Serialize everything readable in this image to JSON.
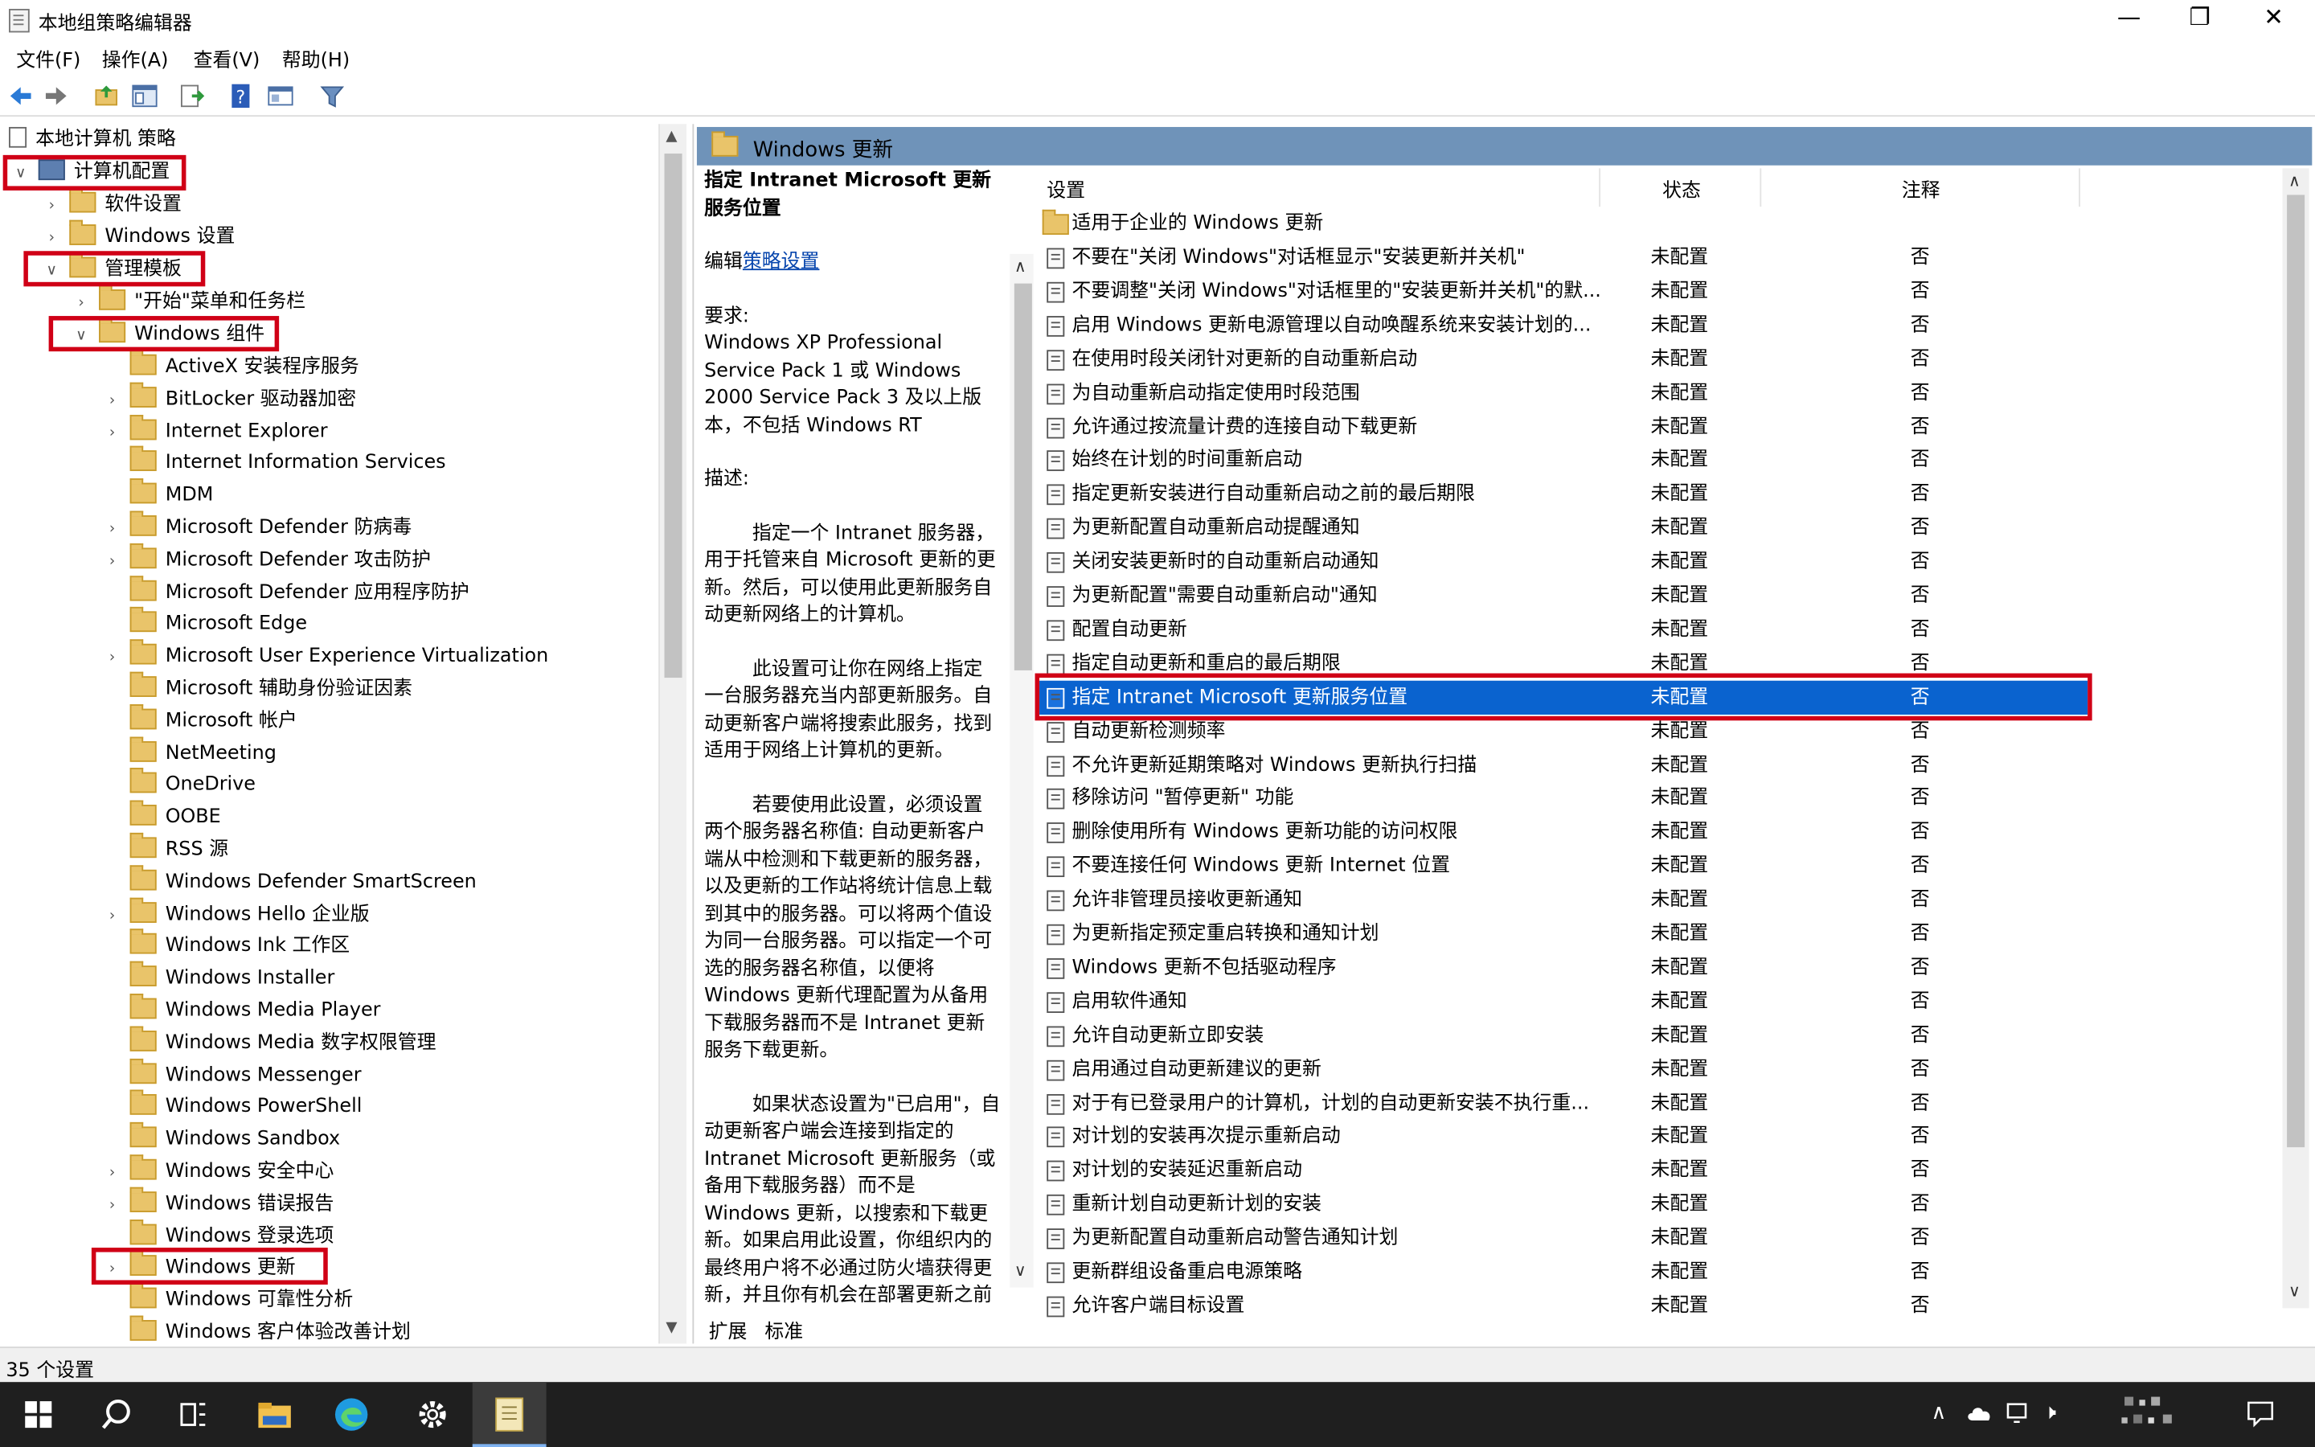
{
  "window": {
    "title": "本地组策略编辑器"
  },
  "menu": [
    "文件(F)",
    "操作(A)",
    "查看(V)",
    "帮助(H)"
  ],
  "tree": {
    "root": "本地计算机 策略",
    "computer_config": "计算机配置",
    "software_settings": "软件设置",
    "windows_settings": "Windows 设置",
    "admin_templates": "管理模板",
    "start_menu": "\"开始\"菜单和任务栏",
    "windows_components": "Windows 组件",
    "components": [
      "ActiveX 安装程序服务",
      "BitLocker 驱动器加密",
      "Internet Explorer",
      "Internet Information Services",
      "MDM",
      "Microsoft Defender 防病毒",
      "Microsoft Defender 攻击防护",
      "Microsoft Defender 应用程序防护",
      "Microsoft Edge",
      "Microsoft User Experience Virtualization",
      "Microsoft 辅助身份验证因素",
      "Microsoft 帐户",
      "NetMeeting",
      "OneDrive",
      "OOBE",
      "RSS 源",
      "Windows Defender SmartScreen",
      "Windows Hello 企业版",
      "Windows Ink 工作区",
      "Windows Installer",
      "Windows Media Player",
      "Windows Media 数字权限管理",
      "Windows Messenger",
      "Windows PowerShell",
      "Windows Sandbox",
      "Windows 安全中心",
      "Windows 错误报告",
      "Windows 登录选项",
      "Windows 更新",
      "Windows 可靠性分析",
      "Windows 客户体验改善计划"
    ]
  },
  "right_header": "Windows 更新",
  "description": {
    "title": "指定 Intranet Microsoft 更新服务位置",
    "edit_prefix": "编辑",
    "edit_link": "策略设置",
    "req_label": "要求:",
    "req_text": "Windows XP Professional Service Pack 1 或 Windows 2000 Service Pack 3 及以上版本，不包括 Windows RT",
    "desc_label": "描述:",
    "p1": "指定一个 Intranet 服务器，用于托管来自 Microsoft 更新的更新。然后，可以使用此更新服务自动更新网络上的计算机。",
    "p2": "此设置可让你在网络上指定一台服务器充当内部更新服务。自动更新客户端将搜索此服务，找到适用于网络上计算机的更新。",
    "p3": "若要使用此设置，必须设置两个服务器名称值: 自动更新客户端从中检测和下载更新的服务器，以及更新的工作站将统计信息上载到其中的服务器。可以将两个值设为同一台服务器。可以指定一个可选的服务器名称值，以便将 Windows 更新代理配置为从备用下载服务器而不是 Intranet 更新服务下载更新。",
    "p4": "如果状态设置为\"已启用\"，自动更新客户端会连接到指定的 Intranet Microsoft 更新服务（或备用下载服务器）而不是 Windows 更新，以搜索和下载更新。如果启用此设置，你组织内的最终用户将不必通过防火墙获得更新，并且你有机会在部署更新之前对其进行测试。"
  },
  "tabs": [
    "扩展",
    "标准"
  ],
  "columns": {
    "setting": "设置",
    "state": "状态",
    "note": "注释"
  },
  "folder_row": "适用于企业的 Windows 更新",
  "rows": [
    {
      "name": "不要在\"关闭 Windows\"对话框显示\"安装更新并关机\"",
      "state": "未配置",
      "note": "否"
    },
    {
      "name": "不要调整\"关闭 Windows\"对话框里的\"安装更新并关机\"的默...",
      "state": "未配置",
      "note": "否"
    },
    {
      "name": "启用 Windows 更新电源管理以自动唤醒系统来安装计划的...",
      "state": "未配置",
      "note": "否"
    },
    {
      "name": "在使用时段关闭针对更新的自动重新启动",
      "state": "未配置",
      "note": "否"
    },
    {
      "name": "为自动重新启动指定使用时段范围",
      "state": "未配置",
      "note": "否"
    },
    {
      "name": "允许通过按流量计费的连接自动下载更新",
      "state": "未配置",
      "note": "否"
    },
    {
      "name": "始终在计划的时间重新启动",
      "state": "未配置",
      "note": "否"
    },
    {
      "name": "指定更新安装进行自动重新启动之前的最后期限",
      "state": "未配置",
      "note": "否"
    },
    {
      "name": "为更新配置自动重新启动提醒通知",
      "state": "未配置",
      "note": "否"
    },
    {
      "name": "关闭安装更新时的自动重新启动通知",
      "state": "未配置",
      "note": "否"
    },
    {
      "name": "为更新配置\"需要自动重新启动\"通知",
      "state": "未配置",
      "note": "否"
    },
    {
      "name": "配置自动更新",
      "state": "未配置",
      "note": "否"
    },
    {
      "name": "指定自动更新和重启的最后期限",
      "state": "未配置",
      "note": "否"
    },
    {
      "name": "指定 Intranet Microsoft 更新服务位置",
      "state": "未配置",
      "note": "否"
    },
    {
      "name": "自动更新检测频率",
      "state": "未配置",
      "note": "否"
    },
    {
      "name": "不允许更新延期策略对 Windows 更新执行扫描",
      "state": "未配置",
      "note": "否"
    },
    {
      "name": "移除访问 \"暂停更新\" 功能",
      "state": "未配置",
      "note": "否"
    },
    {
      "name": "删除使用所有 Windows 更新功能的访问权限",
      "state": "未配置",
      "note": "否"
    },
    {
      "name": "不要连接任何 Windows 更新 Internet 位置",
      "state": "未配置",
      "note": "否"
    },
    {
      "name": "允许非管理员接收更新通知",
      "state": "未配置",
      "note": "否"
    },
    {
      "name": "为更新指定预定重启转换和通知计划",
      "state": "未配置",
      "note": "否"
    },
    {
      "name": "Windows 更新不包括驱动程序",
      "state": "未配置",
      "note": "否"
    },
    {
      "name": "启用软件通知",
      "state": "未配置",
      "note": "否"
    },
    {
      "name": "允许自动更新立即安装",
      "state": "未配置",
      "note": "否"
    },
    {
      "name": "启用通过自动更新建议的更新",
      "state": "未配置",
      "note": "否"
    },
    {
      "name": "对于有已登录用户的计算机，计划的自动更新安装不执行重...",
      "state": "未配置",
      "note": "否"
    },
    {
      "name": "对计划的安装再次提示重新启动",
      "state": "未配置",
      "note": "否"
    },
    {
      "name": "对计划的安装延迟重新启动",
      "state": "未配置",
      "note": "否"
    },
    {
      "name": "重新计划自动更新计划的安装",
      "state": "未配置",
      "note": "否"
    },
    {
      "name": "为更新配置自动重新启动警告通知计划",
      "state": "未配置",
      "note": "否"
    },
    {
      "name": "更新群组设备重启电源策略",
      "state": "未配置",
      "note": "否"
    },
    {
      "name": "允许客户端目标设置",
      "state": "未配置",
      "note": "否"
    }
  ],
  "status": "35 个设置"
}
